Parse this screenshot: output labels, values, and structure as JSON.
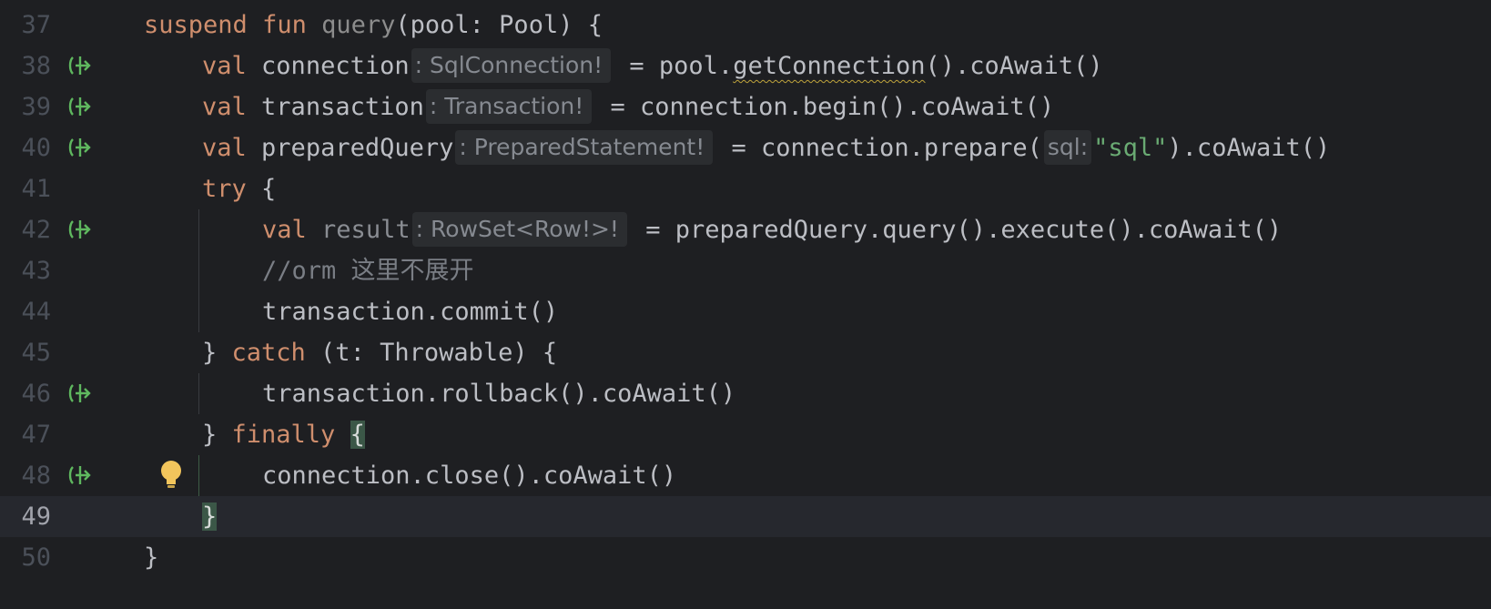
{
  "gutter": {
    "line_numbers": [
      "37",
      "38",
      "39",
      "40",
      "41",
      "42",
      "43",
      "44",
      "45",
      "46",
      "47",
      "48",
      "49",
      "50"
    ],
    "suspend_icon": "suspend-call-icon",
    "bulb_icon": "intention-lightbulb-icon"
  },
  "code": {
    "l37": {
      "suspend": "suspend",
      "fun": "fun",
      "name": "query",
      "rest": "(pool: Pool) {"
    },
    "l38": {
      "val": "val",
      "var": "connection",
      "hint": ": SqlConnection!",
      "eq": " = pool.",
      "warn": "getConnection",
      "rest": "().coAwait()"
    },
    "l39": {
      "val": "val",
      "var": "transaction",
      "hint": ": Transaction!",
      "rest": " = connection.begin().coAwait()"
    },
    "l40": {
      "val": "val",
      "var": "preparedQuery",
      "hint": ": PreparedStatement!",
      "pre": " = connection.prepare(",
      "param_hint": "sql:",
      "str": "\"sql\"",
      "rest": ").coAwait()"
    },
    "l41": {
      "try": "try",
      "rest": " {"
    },
    "l42": {
      "val": "val",
      "var": "result",
      "hint": ": RowSet<Row!>!",
      "rest": " = preparedQuery.query().execute().coAwait()"
    },
    "l43": {
      "comment": "//orm 这里不展开"
    },
    "l44": {
      "text": "transaction.commit()"
    },
    "l45": {
      "close": "} ",
      "catch": "catch",
      "rest": " (t: Throwable) {"
    },
    "l46": {
      "text": "transaction.rollback().coAwait()"
    },
    "l47": {
      "close": "} ",
      "finally": "finally",
      "brace": "{"
    },
    "l48": {
      "text": "connection.close().coAwait()"
    },
    "l49": {
      "brace": "}"
    },
    "l50": {
      "brace": "}"
    }
  },
  "colors": {
    "background": "#1e1f22",
    "current_line": "#26282e",
    "keyword": "#cf8e6d",
    "string": "#6aab73",
    "suspend_icon": "#5fb85f",
    "bulb": "#f2c55c"
  }
}
